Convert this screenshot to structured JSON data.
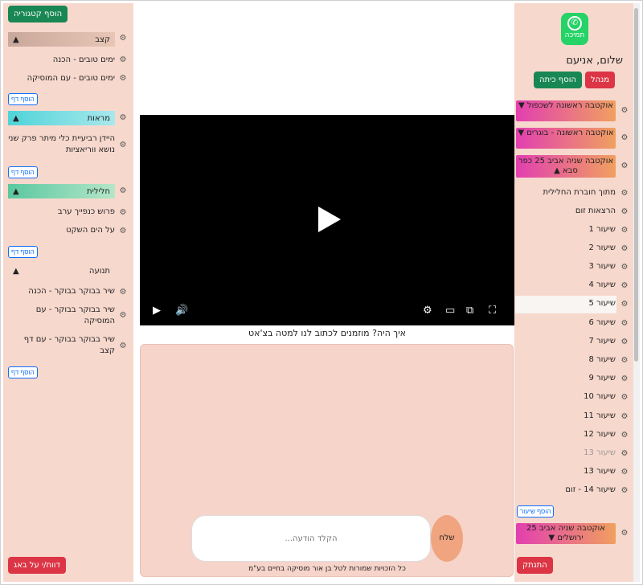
{
  "left": {
    "add_category": "הוסף קטגוריה",
    "add_page": "הוסף דף",
    "report": "דווח/י על באג",
    "categories": [
      {
        "name": "קצב",
        "arrow": "▲",
        "items": [
          "ימים טובים - הכנה",
          "ימים טובים - עם המוסיקה"
        ]
      },
      {
        "name": "מראות",
        "arrow": "▲",
        "items": [
          "היידן רביעיית כלי מיתר פרק שני נושא ווריאציות"
        ]
      },
      {
        "name": "חלילית",
        "arrow": "▲",
        "items": [
          "פרוש כנפייך ערב",
          "על הים השקט"
        ]
      },
      {
        "name": "תנועה",
        "arrow": "▲",
        "items": [
          "שיר בבוקר בבוקר - הכנה",
          "שיר בבוקר בבוקר - עם המוסיקה",
          "שיר בבוקר בבוקר - עם דף קצב"
        ]
      }
    ],
    "colors": {
      "qetzev": "#c9a89b",
      "marot": "#4fd4d9",
      "chalilit": "#5ac8a0"
    }
  },
  "center": {
    "prompt": "איך היה? מוזמנים לכתוב לנו למטה בצ'אט",
    "input_placeholder": "הקלד הודעה...",
    "send": "שלח",
    "copyright": "כל הזכויות שמורות לטל בן אור מוסיקה בחיים בע\"מ"
  },
  "right": {
    "wa_label": "תמיכה",
    "greeting": "שלום, אניעם",
    "admin": "מנהל",
    "add_class": "הוסף כיתה",
    "classes": [
      {
        "name": "אוקטבה ראשונה לשכפול",
        "arrow": "▼"
      },
      {
        "name": "אוקטבה ראשונה - בוגרים",
        "arrow": "▼"
      },
      {
        "name": "אוקטבה שניה אביב 25 כפר סבא",
        "arrow": "▲"
      }
    ],
    "lessons": [
      "מתוך חוברת החלילית",
      "הרצאות זום",
      "שיעור 1",
      "שיעור 2",
      "שיעור 3",
      "שיעור 4",
      "שיעור 5",
      "שיעור 6",
      "שיעור 7",
      "שיעור 8",
      "שיעור 9",
      "שיעור 10",
      "שיעור 11",
      "שיעור 12",
      "שיעור 13",
      "שיעור 13",
      "שיעור 14 - זום"
    ],
    "add_lesson": "הוסף שיעור",
    "last_class": {
      "name": "אוקטבה שניה אביב 25 ירושלים",
      "arrow": "▼"
    },
    "logout": "התנתק",
    "colors": {
      "class_gradient_a": "#f0a060",
      "class_gradient_b": "#e23fb0"
    }
  }
}
